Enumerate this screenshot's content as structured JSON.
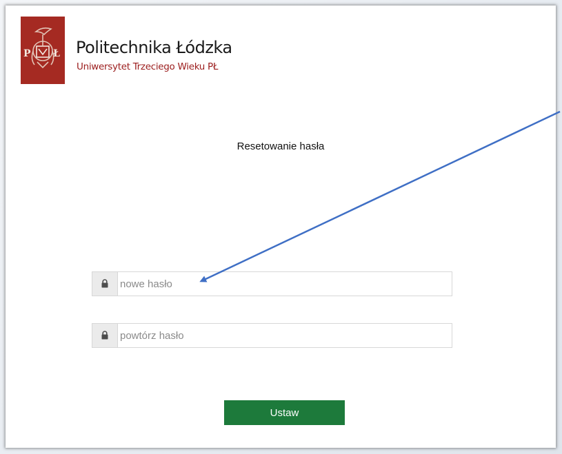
{
  "header": {
    "university_name": "Politechnika Łódzka",
    "subtitle": "Uniwersytet Trzeciego Wieku PŁ",
    "logo_icon": "politechnika-lodzka-logo"
  },
  "main": {
    "title": "Resetowanie hasła",
    "new_password": {
      "placeholder": "nowe hasło",
      "value": "",
      "icon": "lock-icon"
    },
    "repeat_password": {
      "placeholder": "powtórz hasło",
      "value": "",
      "icon": "lock-icon"
    },
    "submit_label": "Ustaw"
  },
  "colors": {
    "brand_red": "#a52a22",
    "subtitle_red": "#9b1c1c",
    "button_green": "#1d7a3b",
    "annotation_arrow": "#3f6fc5"
  }
}
